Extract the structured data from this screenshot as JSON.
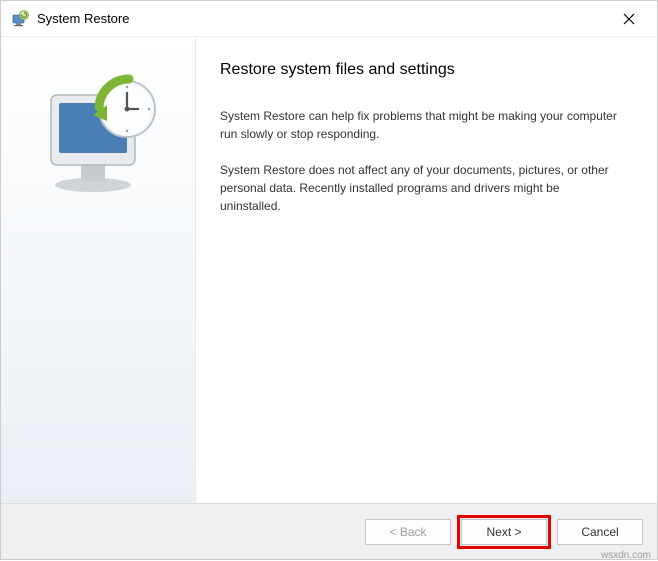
{
  "titlebar": {
    "title": "System Restore"
  },
  "main": {
    "heading": "Restore system files and settings",
    "paragraph1": "System Restore can help fix problems that might be making your computer run slowly or stop responding.",
    "paragraph2": "System Restore does not affect any of your documents, pictures, or other personal data. Recently installed programs and drivers might be uninstalled."
  },
  "footer": {
    "back_label": "< Back",
    "next_label": "Next >",
    "cancel_label": "Cancel"
  },
  "watermark": "wsxdn.com"
}
